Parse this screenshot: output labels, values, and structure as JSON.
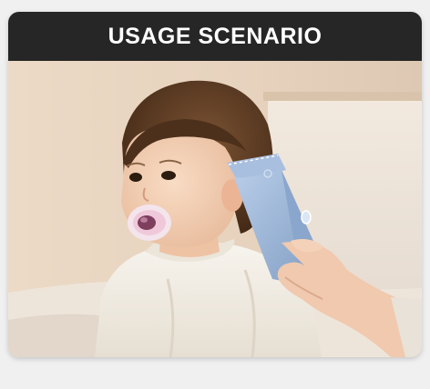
{
  "banner": {
    "title": "USAGE SCENARIO"
  },
  "colors": {
    "banner_bg": "#262626",
    "banner_text": "#ffffff",
    "wall": "#e8d6c2",
    "clipper_body": "#9fb8d8",
    "shirt": "#f3efe6",
    "hair": "#5a3a22",
    "skin": "#f3cfb3"
  },
  "icons": {
    "clipper": "hair-clipper",
    "pacifier": "pacifier"
  }
}
